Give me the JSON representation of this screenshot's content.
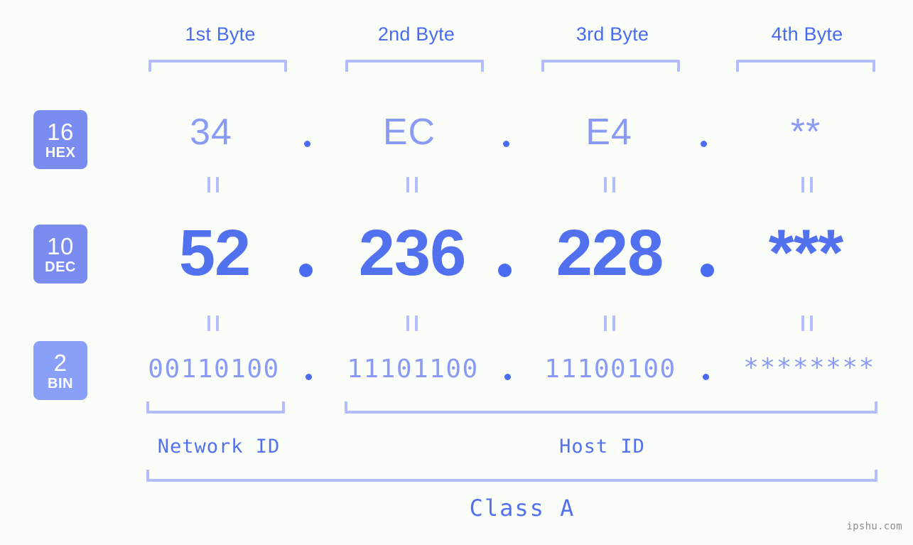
{
  "page": {
    "background_color": "#fbfdf8",
    "accent_color": "#5271ef",
    "accent_light_color": "#8a9bf5",
    "bracket_color": "#b3bdfb",
    "watermark": "ipshu.com"
  },
  "columns": [
    {
      "label": "1st Byte"
    },
    {
      "label": "2nd Byte"
    },
    {
      "label": "3rd Byte"
    },
    {
      "label": "4th Byte"
    }
  ],
  "bases": [
    {
      "num": "16",
      "name": "HEX",
      "badge_color": "#7a8cf0"
    },
    {
      "num": "10",
      "name": "DEC",
      "badge_color": "#7a8cf0"
    },
    {
      "num": "2",
      "name": "BIN",
      "badge_color": "#8aa0f8"
    }
  ],
  "rows": {
    "hex": {
      "base_num": "16",
      "base_name": "HEX",
      "values": [
        "34",
        "EC",
        "E4",
        "**"
      ],
      "separator": "."
    },
    "dec": {
      "base_num": "10",
      "base_name": "DEC",
      "values": [
        "52",
        "236",
        "228",
        "***"
      ],
      "separator": "."
    },
    "bin": {
      "base_num": "2",
      "base_name": "BIN",
      "values": [
        "00110100",
        "11101100",
        "11100100",
        "********"
      ],
      "separator": "."
    }
  },
  "equals_symbol": "=",
  "segments": {
    "network_id": "Network ID",
    "host_id": "Host ID",
    "class": "Class A"
  }
}
